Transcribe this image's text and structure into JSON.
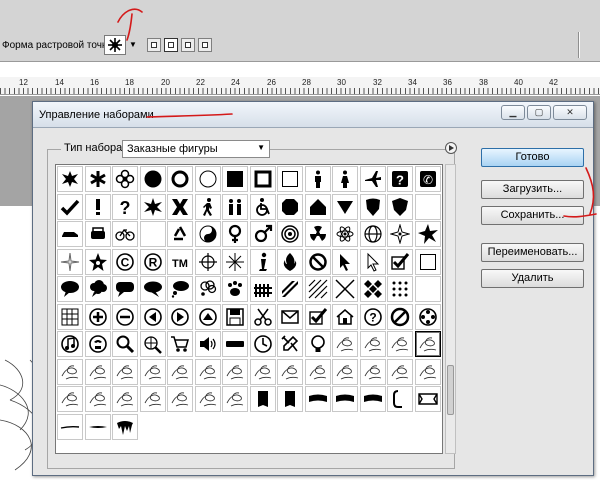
{
  "options_bar": {
    "brush_label": "Форма растровой точки:",
    "dropdown_icon": "triangle-down",
    "mode_icons": [
      "new-layer-mode",
      "paths-mode",
      "fill-pixels-mode",
      "combine-mode"
    ]
  },
  "ruler": {
    "labels": [
      "12",
      "14",
      "16",
      "18",
      "20",
      "22",
      "24",
      "26",
      "28",
      "30",
      "32",
      "34",
      "36",
      "38",
      "40",
      "42"
    ]
  },
  "dialog": {
    "title": "Управление наборами",
    "window_buttons": [
      "minimize",
      "restore",
      "close"
    ],
    "type_label": "Тип набора:",
    "type_value": "Заказные фигуры",
    "buttons": {
      "done": "Готово",
      "load": "Загрузить...",
      "save": "Сохранить...",
      "rename": "Переименовать...",
      "delete": "Удалить"
    },
    "grid": {
      "columns": 14,
      "rows": [
        [
          "splat",
          "asterisk",
          "flower",
          "circle",
          "ring",
          "circle-outline",
          "square",
          "square-frame",
          "square-outline",
          "man",
          "woman",
          "airplane",
          "help",
          "phone"
        ],
        [
          "check",
          "exclamation",
          "question",
          "burst",
          "x",
          "pedestrian",
          "family",
          "wheelchair",
          "octagon",
          "home",
          "triangle-down",
          "shield",
          "shield2",
          "blank"
        ],
        [
          "car-side",
          "car-front",
          "bicycle",
          "blank",
          "recycle",
          "yin-yang",
          "female",
          "male",
          "target",
          "radiation",
          "atom",
          "globe",
          "compass",
          "burst2"
        ],
        [
          "sparkle",
          "star-badge",
          "copyright",
          "registered",
          "trademark",
          "crosshair",
          "starburst",
          "info",
          "fire",
          "no-sign",
          "cursor",
          "cursor-outline",
          "checkbox",
          "square-outline"
        ],
        [
          "speech-oval",
          "speech-cloud",
          "speech-rect",
          "speech-bubble",
          "thought-bubble",
          "thought-cloud",
          "paw",
          "fence",
          "bars",
          "stripes",
          "zigzag",
          "diamonds",
          "dots",
          "blank"
        ],
        [
          "grid-table",
          "plus",
          "minus",
          "arrow-left",
          "arrow-right",
          "arrow-up",
          "save",
          "scissors",
          "envelope",
          "checkbox",
          "house",
          "question-circle",
          "no-circle",
          "film-reel"
        ],
        [
          "music-note",
          "phone-circle",
          "magnifier",
          "web",
          "cart",
          "speaker",
          "bar",
          "clock",
          "tools",
          "lightbulb",
          "calligraphy",
          "calligraphy",
          "calligraphy",
          "calligraphy"
        ],
        [
          "calligraphy",
          "calligraphy",
          "calligraphy",
          "calligraphy",
          "calligraphy",
          "calligraphy",
          "calligraphy",
          "calligraphy",
          "calligraphy",
          "calligraphy",
          "calligraphy",
          "calligraphy",
          "calligraphy",
          "calligraphy"
        ],
        [
          "calligraphy",
          "calligraphy",
          "calligraphy",
          "calligraphy",
          "calligraphy",
          "calligraphy",
          "calligraphy",
          "banner-tall",
          "banner-tall",
          "banner-wide",
          "banner-wide",
          "banner-wide",
          "bracket",
          "banner-frame"
        ],
        [
          "line-stroke",
          "line-taper",
          "ink-blot"
        ]
      ],
      "selected": "6-13"
    }
  }
}
